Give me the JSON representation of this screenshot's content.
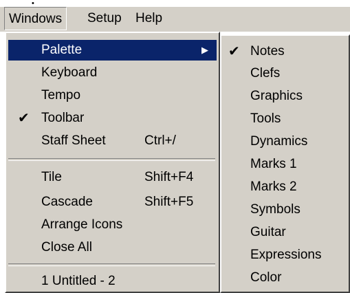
{
  "menubar": {
    "items": [
      {
        "label": "Windows"
      },
      {
        "label": "Setup"
      },
      {
        "label": "Help"
      }
    ]
  },
  "windows_menu": {
    "items": [
      {
        "label": "Palette",
        "submenu": true,
        "highlighted": true
      },
      {
        "label": "Keyboard"
      },
      {
        "label": "Tempo"
      },
      {
        "label": "Toolbar",
        "checked": true
      },
      {
        "label": "Staff Sheet",
        "shortcut": "Ctrl+/"
      },
      {
        "label": "Tile",
        "shortcut": "Shift+F4"
      },
      {
        "label": "Cascade",
        "shortcut": "Shift+F5"
      },
      {
        "label": "Arrange Icons"
      },
      {
        "label": "Close All"
      },
      {
        "label": "1 Untitled - 2"
      }
    ]
  },
  "palette_submenu": {
    "items": [
      {
        "label": "Notes",
        "checked": true
      },
      {
        "label": "Clefs"
      },
      {
        "label": "Graphics"
      },
      {
        "label": "Tools"
      },
      {
        "label": "Dynamics"
      },
      {
        "label": "Marks 1"
      },
      {
        "label": "Marks 2"
      },
      {
        "label": "Symbols"
      },
      {
        "label": "Guitar"
      },
      {
        "label": "Expressions"
      },
      {
        "label": "Color"
      }
    ]
  },
  "icons": {
    "check": "✔",
    "submenu_arrow": "▶"
  },
  "colors": {
    "menu_bg": "#d4d0c8",
    "highlight": "#0a246a"
  }
}
